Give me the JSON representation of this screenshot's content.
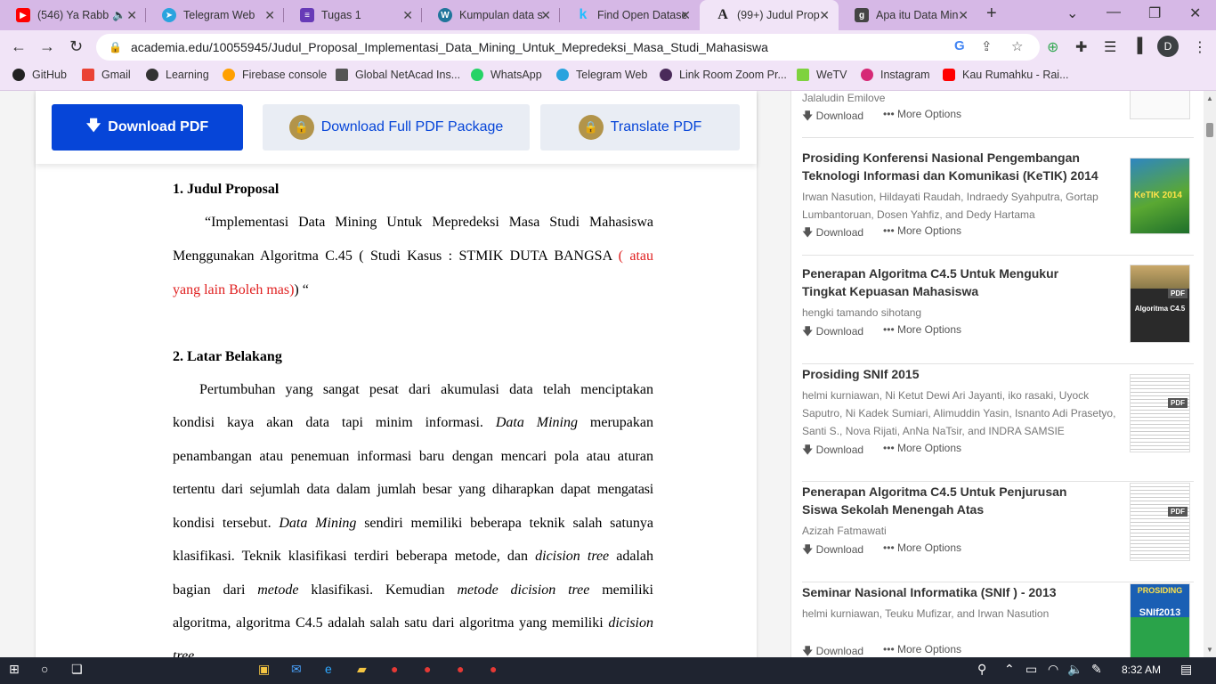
{
  "tabs": [
    {
      "title": "(546) Ya Rabb",
      "icon": "youtube-icon"
    },
    {
      "title": "Telegram Web",
      "icon": "telegram-icon"
    },
    {
      "title": "Tugas 1",
      "icon": "forms-icon"
    },
    {
      "title": "Kumpulan data s",
      "icon": "wordpress-icon"
    },
    {
      "title": "Find Open Datase",
      "icon": "kaggle-icon"
    },
    {
      "title": "(99+) Judul Prop",
      "icon": "academia-icon"
    },
    {
      "title": "Apa itu Data Min",
      "icon": "site-icon"
    }
  ],
  "address": "academia.edu/10055945/Judul_Proposal_Implementasi_Data_Mining_Untuk_Mepredeksi_Masa_Studi_Mahasiswa",
  "profile_initial": "D",
  "bookmarks": [
    "GitHub",
    "Gmail",
    "Learning",
    "Firebase console",
    "Global NetAcad Ins...",
    "WhatsApp",
    "Telegram Web",
    "Link Room Zoom Pr...",
    "WeTV",
    "Instagram",
    "Kau Rumahku - Rai..."
  ],
  "buttons": {
    "download": "Download PDF",
    "full": "Download Full PDF Package",
    "translate": "Translate PDF"
  },
  "doc": {
    "h1": "1.   Judul Proposal",
    "p1_l1": "“Implementasi Data Mining Untuk Mepredeksi Masa Studi Mahasiswa",
    "p1_l2a": "Menggunakan Algoritma C.45 ( Studi Kasus : STMIK DUTA BANGSA ",
    "p1_l2b": "( atau",
    "p1_l3a": "yang lain Boleh mas)",
    "p1_l3b": ") “",
    "h2": "2.   Latar Belakang",
    "l1": "Pertumbuhan yang sangat pesat dari akumulasi data telah menciptakan",
    "l2a": "kondisi kaya akan data tapi minim informasi. ",
    "l2b": "Data Mining",
    "l2c": " merupakan",
    "l3": "penambangan atau penemuan informasi baru dengan mencari pola atau aturan",
    "l4": "tertentu dari sejumlah data dalam jumlah besar yang diharapkan dapat mengatasi",
    "l5a": "kondisi tersebut. ",
    "l5b": "Data Mining",
    "l5c": " sendiri memiliki beberapa teknik salah satunya",
    "l6a": "klasifikasi. Teknik klasifikasi terdiri beberapa metode, dan ",
    "l6b": "dicision tree",
    "l6c": " adalah",
    "l7a": "bagian dari ",
    "l7b": "metode",
    "l7c": " klasifikasi. Kemudian ",
    "l7d": "metode dicision tree",
    "l7e": " memiliki",
    "l8a": "algoritma, algoritma C4.5  adalah salah satu dari algoritma yang memiliki ",
    "l8b": "dicision",
    "l9": "tree"
  },
  "side": {
    "download": "Download",
    "more": "More Options",
    "first_author": "Jalaludin Emilove",
    "items": [
      {
        "title": "Prosiding Konferensi Nasional Pengembangan Teknologi Informasi dan Komunikasi (KeTIK) 2014",
        "authors": "Irwan Nasution, Hildayati Raudah, Indraedy Syahputra, Gortap Lumbantoruan, Dosen Yahfiz, and Dedy Hartama"
      },
      {
        "title": "Penerapan Algoritma C4.5 Untuk Mengukur Tingkat Kepuasan Mahasiswa",
        "authors": "hengki tamando sihotang"
      },
      {
        "title": "Prosiding SNIf 2015",
        "authors": "helmi kurniawan, Ni Ketut Dewi Ari Jayanti, iko rasaki, Uyock Saputro, Ni Kadek Sumiari, Alimuddin Yasin, Isnanto Adi Prasetyo, Santi S., Nova Rijati, AnNa NaTsir, and INDRA SAMSIE"
      },
      {
        "title": "Penerapan Algoritma C4.5 Untuk Penjurusan Siswa Sekolah Menengah Atas",
        "authors": "Azizah Fatmawati"
      },
      {
        "title": "Seminar Nasional Informatika (SNIf ) - 2013",
        "authors": "helmi kurniawan, Teuku Mufizar, and Irwan Nasution"
      }
    ],
    "thumb_text": {
      "ketik": "KeTIK 2014",
      "algo": "Algoritma C4.5",
      "prosiding": "PROSIDING",
      "snif": "SNIf2013",
      "pdf": "PDF"
    }
  },
  "time": "8:32 AM"
}
